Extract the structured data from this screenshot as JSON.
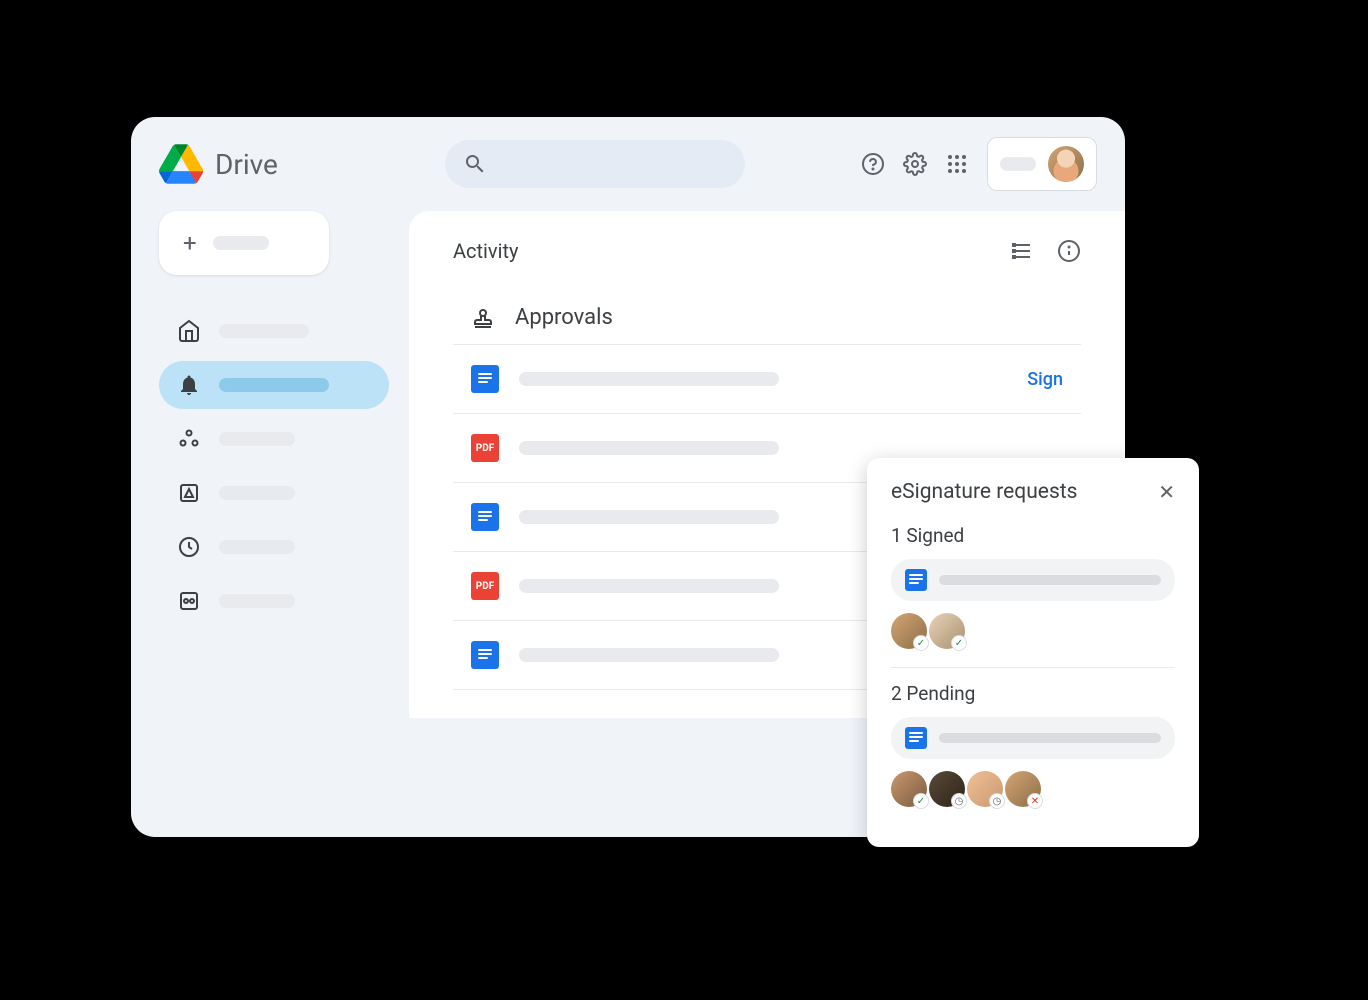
{
  "header": {
    "app_title": "Drive"
  },
  "content": {
    "panel_title": "Activity",
    "section_title": "Approvals",
    "sign_action": "Sign",
    "rows": [
      {
        "type": "doc",
        "has_sign": true
      },
      {
        "type": "pdf",
        "has_sign": false
      },
      {
        "type": "doc",
        "has_sign": false
      },
      {
        "type": "pdf",
        "has_sign": false
      },
      {
        "type": "doc",
        "has_sign": false
      }
    ]
  },
  "popup": {
    "title": "eSignature requests",
    "sections": [
      {
        "label": "1 Signed",
        "signers": [
          {
            "status": "check"
          },
          {
            "status": "check"
          }
        ]
      },
      {
        "label": "2 Pending",
        "signers": [
          {
            "status": "check"
          },
          {
            "status": "clock"
          },
          {
            "status": "clock"
          },
          {
            "status": "x"
          }
        ]
      }
    ]
  },
  "icons": {
    "pdf_label": "PDF"
  }
}
